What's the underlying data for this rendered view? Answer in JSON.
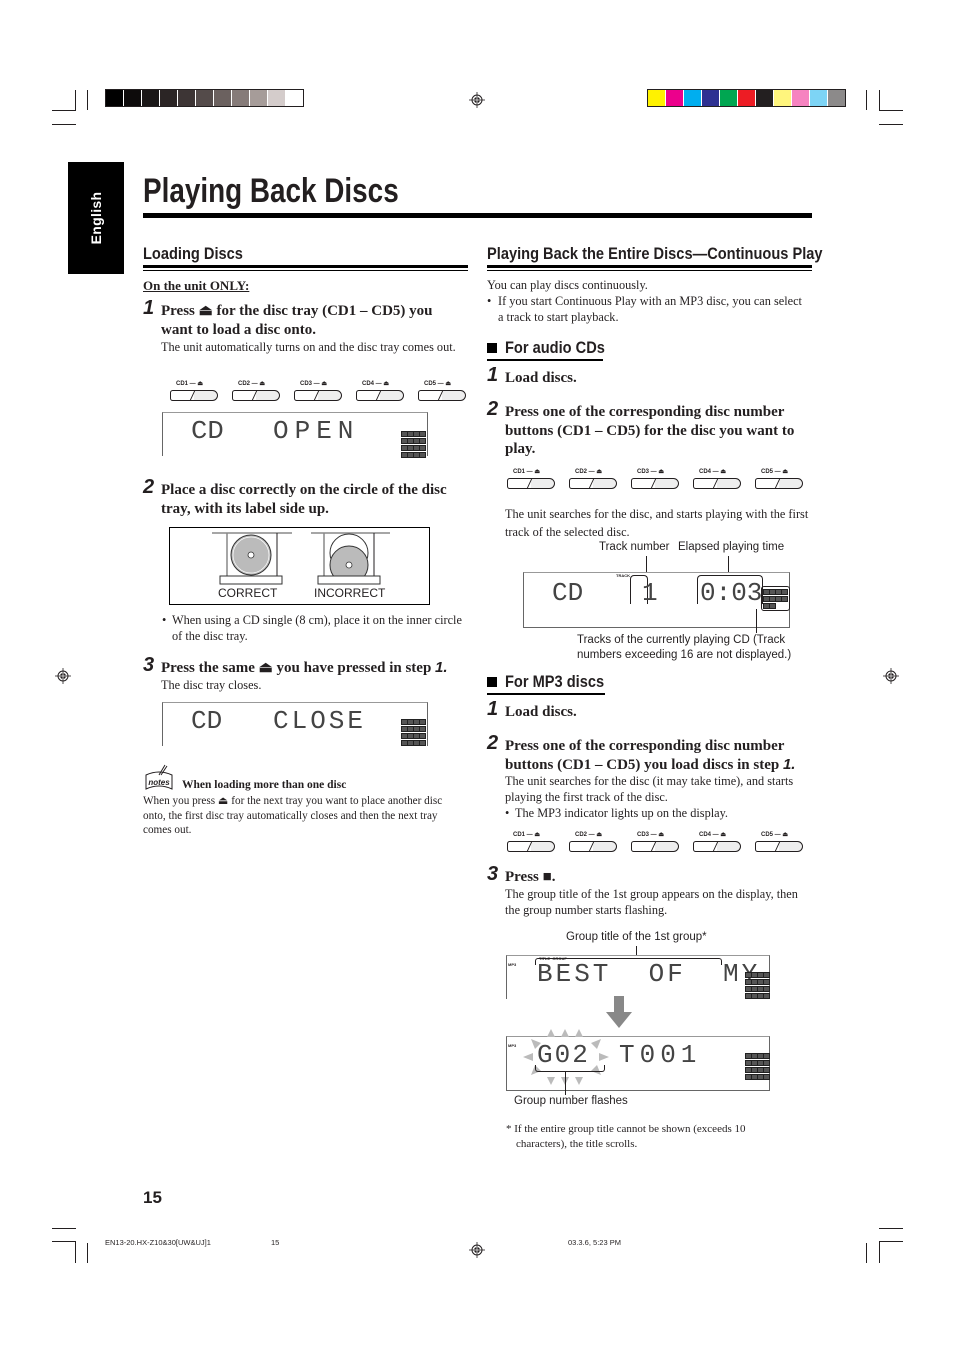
{
  "print_marks": {
    "grayscale_bar": [
      "#000000",
      "#0d0b0b",
      "#1a1717",
      "#2b2525",
      "#3d3535",
      "#544b4a",
      "#6b615f",
      "#867b79",
      "#a69c99",
      "#d4cccb",
      "#ffffff"
    ],
    "color_bar": [
      "#fff200",
      "#ec008c",
      "#00aeef",
      "#2e3192",
      "#00a651",
      "#ed1c24",
      "#231f20",
      "#fff57d",
      "#f683c0",
      "#7dd4f5",
      "#8c8a8a"
    ]
  },
  "language_tab": "English",
  "page_title": "Playing Back Discs",
  "loading": {
    "heading": "Loading Discs",
    "on_unit_only": "On the unit ONLY:",
    "step1": {
      "num": "1",
      "text": "Press ⏏ for the disc tray (CD1 – CD5) you want to load a disc onto.",
      "body": "The unit automatically turns on and the disc tray comes out."
    },
    "cd_buttons": [
      "CD1 — ⏏",
      "CD2 — ⏏",
      "CD3 — ⏏",
      "CD4 — ⏏",
      "CD5 — ⏏"
    ],
    "display_open": {
      "left": "CD",
      "right": "OPEN"
    },
    "step2": {
      "num": "2",
      "text": "Place a disc correctly on the circle of the disc tray, with its label side up."
    },
    "figure_labels": {
      "correct": "CORRECT",
      "incorrect": "INCORRECT"
    },
    "step2_bullet": "When using a CD single (8 cm), place it on the inner circle of the disc tray.",
    "step3": {
      "num": "3",
      "text_a": "Press the same ⏏ you have pressed in step ",
      "text_ref": "1.",
      "body": "The disc tray closes."
    },
    "display_close": {
      "left": "CD",
      "right": "CLOSE"
    },
    "notes_icon": "notes",
    "notes_title": "When loading more than one disc",
    "notes_body": "When you press ⏏ for the next tray you want to place another disc onto, the first disc tray automatically closes and then the next tray comes out."
  },
  "continuous": {
    "heading": "Playing Back the Entire Discs—Continuous Play",
    "intro": "You can play discs continuously.",
    "intro_bullet": "If you start Continuous Play with an MP3 disc, you can select a track to start playback.",
    "audio": {
      "heading": "For audio CDs",
      "step1": {
        "num": "1",
        "text": "Load discs."
      },
      "step2": {
        "num": "2",
        "text": "Press one of the corresponding disc number buttons (CD1 – CD5) for the disc you want to play."
      },
      "cd_buttons": [
        "CD1 — ⏏",
        "CD2 — ⏏",
        "CD3 — ⏏",
        "CD4 — ⏏",
        "CD5 — ⏏"
      ],
      "body": "The unit searches for the disc, and starts playing with the first track of the selected disc.",
      "callout_track": "Track number",
      "callout_time": "Elapsed playing time",
      "display": {
        "left": "CD",
        "track_indicator": "TRACK",
        "track": "1",
        "time": "0:03"
      },
      "callout_tracks": "Tracks of the currently playing CD (Track numbers exceeding 16 are not displayed.)"
    },
    "mp3": {
      "heading": "For MP3 discs",
      "step1": {
        "num": "1",
        "text": "Load discs."
      },
      "step2": {
        "num": "2",
        "text_a": "Press one of the corresponding disc number buttons (CD1 – CD5) you load discs in step ",
        "text_ref": "1."
      },
      "body": "The unit searches for the disc (it may take time), and starts playing the first track of the disc.",
      "bullet": "The MP3 indicator lights up on the display.",
      "cd_buttons": [
        "CD1 — ⏏",
        "CD2 — ⏏",
        "CD3 — ⏏",
        "CD4 — ⏏",
        "CD5 — ⏏"
      ],
      "step3": {
        "num": "3",
        "text": "Press ■."
      },
      "step3_body": "The group title of the 1st group appears on the display, then the group number starts flashing.",
      "callout_group_title": "Group title of the 1st group*",
      "display1": {
        "indicators": "MP3",
        "title_label": "TITLE  GROUP",
        "text": "BEST  OF  MY"
      },
      "display2": {
        "indicators": "MP3",
        "group": "G02",
        "track": "T001"
      },
      "callout_group_number": "Group number flashes",
      "footnote": "* If the entire group title cannot be shown (exceeds 10 characters), the title scrolls."
    }
  },
  "page_number": "15",
  "footer": {
    "file": "EN13-20.HX-Z10&30[UW&UJ]1",
    "page": "15",
    "timestamp": "03.3.6, 5:23 PM"
  }
}
